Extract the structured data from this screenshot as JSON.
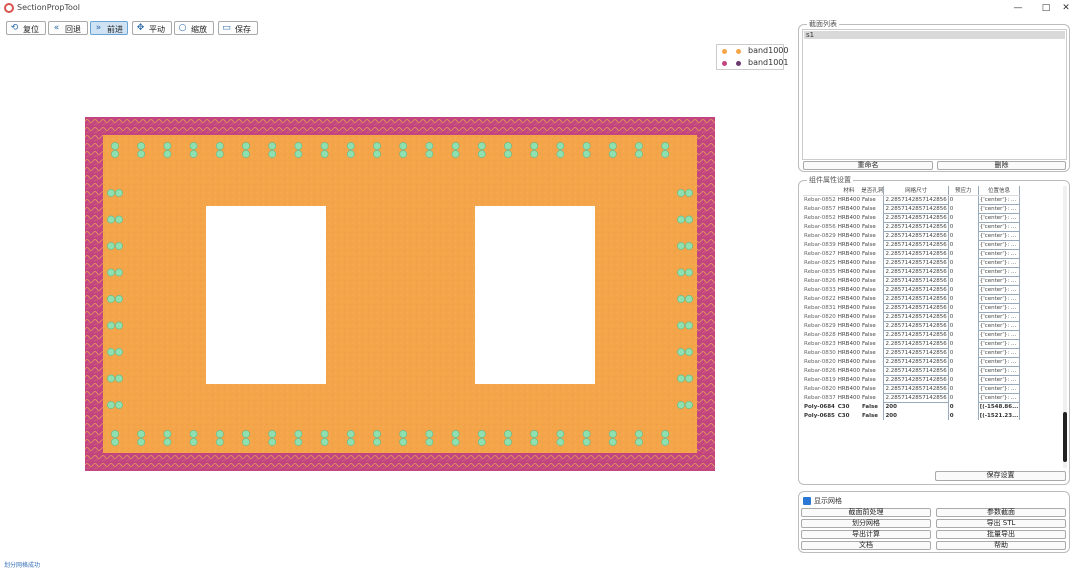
{
  "window": {
    "title": "SectionPropTool",
    "controls": [
      "—",
      "□",
      "✕"
    ]
  },
  "toolbar": {
    "buttons": [
      {
        "label": "复位",
        "icon": "reset-icon"
      },
      {
        "label": "回退",
        "icon": "undo-icon"
      },
      {
        "label": "前进",
        "icon": "redo-icon"
      },
      {
        "label": "平动",
        "icon": "pan-icon"
      },
      {
        "label": "缩放",
        "icon": "zoom-icon"
      },
      {
        "label": "保存",
        "icon": "save-icon"
      }
    ]
  },
  "legend": {
    "items": [
      {
        "label": "band1000",
        "color": "#f4a54a"
      },
      {
        "label": "band1001",
        "color": "#c2457f"
      }
    ]
  },
  "section_list": {
    "title": "截面列表",
    "selected": "s1",
    "buttons": [
      "重命名",
      "删除"
    ]
  },
  "component_props": {
    "title": "组件属性设置",
    "columns": [
      "",
      "材料",
      "是否孔洞",
      "网格尺寸",
      "预应力",
      "位置信息"
    ],
    "rows": [
      {
        "id": "Rebar-0852",
        "mat": "HRB400",
        "flag": "False",
        "size": "2.2857142857142856",
        "pre": "0",
        "pos": "{'center'}: ..."
      },
      {
        "id": "Rebar-0857",
        "mat": "HRB400",
        "flag": "False",
        "size": "2.2857142857142856",
        "pre": "0",
        "pos": "{'center'}: ..."
      },
      {
        "id": "Rebar-0852",
        "mat": "HRB400",
        "flag": "False",
        "size": "2.2857142857142856",
        "pre": "0",
        "pos": "{'center'}: ..."
      },
      {
        "id": "Rebar-0856",
        "mat": "HRB400",
        "flag": "False",
        "size": "2.2857142857142856",
        "pre": "0",
        "pos": "{'center'}: ..."
      },
      {
        "id": "Rebar-0829",
        "mat": "HRB400",
        "flag": "False",
        "size": "2.2857142857142856",
        "pre": "0",
        "pos": "{'center'}: ..."
      },
      {
        "id": "Rebar-0839",
        "mat": "HRB400",
        "flag": "False",
        "size": "2.2857142857142856",
        "pre": "0",
        "pos": "{'center'}: ..."
      },
      {
        "id": "Rebar-0827",
        "mat": "HRB400",
        "flag": "False",
        "size": "2.2857142857142856",
        "pre": "0",
        "pos": "{'center'}: ..."
      },
      {
        "id": "Rebar-0825",
        "mat": "HRB400",
        "flag": "False",
        "size": "2.2857142857142856",
        "pre": "0",
        "pos": "{'center'}: ..."
      },
      {
        "id": "Rebar-0835",
        "mat": "HRB400",
        "flag": "False",
        "size": "2.2857142857142856",
        "pre": "0",
        "pos": "{'center'}: ..."
      },
      {
        "id": "Rebar-0826",
        "mat": "HRB400",
        "flag": "False",
        "size": "2.2857142857142856",
        "pre": "0",
        "pos": "{'center'}: ..."
      },
      {
        "id": "Rebar-0833",
        "mat": "HRB400",
        "flag": "False",
        "size": "2.2857142857142856",
        "pre": "0",
        "pos": "{'center'}: ..."
      },
      {
        "id": "Rebar-0822",
        "mat": "HRB400",
        "flag": "False",
        "size": "2.2857142857142856",
        "pre": "0",
        "pos": "{'center'}: ..."
      },
      {
        "id": "Rebar-0831",
        "mat": "HRB400",
        "flag": "False",
        "size": "2.2857142857142856",
        "pre": "0",
        "pos": "{'center'}: ..."
      },
      {
        "id": "Rebar-0820",
        "mat": "HRB400",
        "flag": "False",
        "size": "2.2857142857142856",
        "pre": "0",
        "pos": "{'center'}: ..."
      },
      {
        "id": "Rebar-0829",
        "mat": "HRB400",
        "flag": "False",
        "size": "2.2857142857142856",
        "pre": "0",
        "pos": "{'center'}: ..."
      },
      {
        "id": "Rebar-0828",
        "mat": "HRB400",
        "flag": "False",
        "size": "2.2857142857142856",
        "pre": "0",
        "pos": "{'center'}: ..."
      },
      {
        "id": "Rebar-0823",
        "mat": "HRB400",
        "flag": "False",
        "size": "2.2857142857142856",
        "pre": "0",
        "pos": "{'center'}: ..."
      },
      {
        "id": "Rebar-0830",
        "mat": "HRB400",
        "flag": "False",
        "size": "2.2857142857142856",
        "pre": "0",
        "pos": "{'center'}: ..."
      },
      {
        "id": "Rebar-0820",
        "mat": "HRB400",
        "flag": "False",
        "size": "2.2857142857142856",
        "pre": "0",
        "pos": "{'center'}: ..."
      },
      {
        "id": "Rebar-0826",
        "mat": "HRB400",
        "flag": "False",
        "size": "2.2857142857142856",
        "pre": "0",
        "pos": "{'center'}: ..."
      },
      {
        "id": "Rebar-0819",
        "mat": "HRB400",
        "flag": "False",
        "size": "2.2857142857142856",
        "pre": "0",
        "pos": "{'center'}: ..."
      },
      {
        "id": "Rebar-0820",
        "mat": "HRB400",
        "flag": "False",
        "size": "2.2857142857142856",
        "pre": "0",
        "pos": "{'center'}: ..."
      },
      {
        "id": "Rebar-0837",
        "mat": "HRB400",
        "flag": "False",
        "size": "2.2857142857142856",
        "pre": "0",
        "pos": "{'center'}: ..."
      },
      {
        "id": "Poly-0684",
        "mat": "C30",
        "flag": "False",
        "size": "200",
        "pre": "0",
        "pos": "[(-1548.86..."
      },
      {
        "id": "Poly-0685",
        "mat": "C30",
        "flag": "False",
        "size": "200",
        "pre": "0",
        "pos": "[(-1521.23..."
      }
    ],
    "save_button": "保存设置"
  },
  "tools": {
    "checkbox_label": "显示网格",
    "buttons": [
      [
        "截面前处理",
        "参数截面"
      ],
      [
        "划分网格",
        "导出 STL"
      ],
      [
        "导出计算",
        "批量导出"
      ],
      [
        "文档",
        "帮助"
      ]
    ]
  },
  "status_bar": "划分网格成功"
}
